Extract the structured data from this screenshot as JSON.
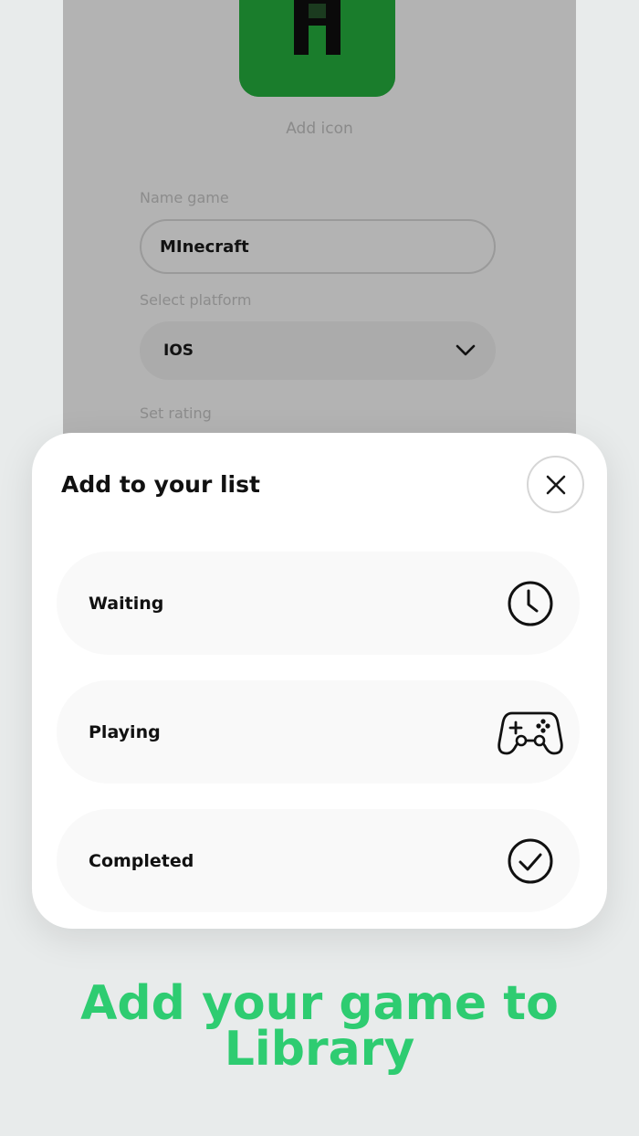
{
  "form": {
    "add_icon_label": "Add icon",
    "name_label": "Name game",
    "name_value": "MInecraft",
    "platform_label": "Select platform",
    "platform_value": "IOS",
    "rating_label": "Set rating"
  },
  "sheet": {
    "title": "Add to your list",
    "options": [
      {
        "label": "Waiting",
        "icon": "clock-icon"
      },
      {
        "label": "Playing",
        "icon": "gamepad-icon"
      },
      {
        "label": "Completed",
        "icon": "check-circle-icon"
      }
    ]
  },
  "promo": {
    "line1": "Add your game to",
    "line2": "Library"
  },
  "colors": {
    "accent": "#2ecc71",
    "icon_green": "#177a2b",
    "overlay": "#b3b3b3",
    "background": "#e8ebeb"
  }
}
